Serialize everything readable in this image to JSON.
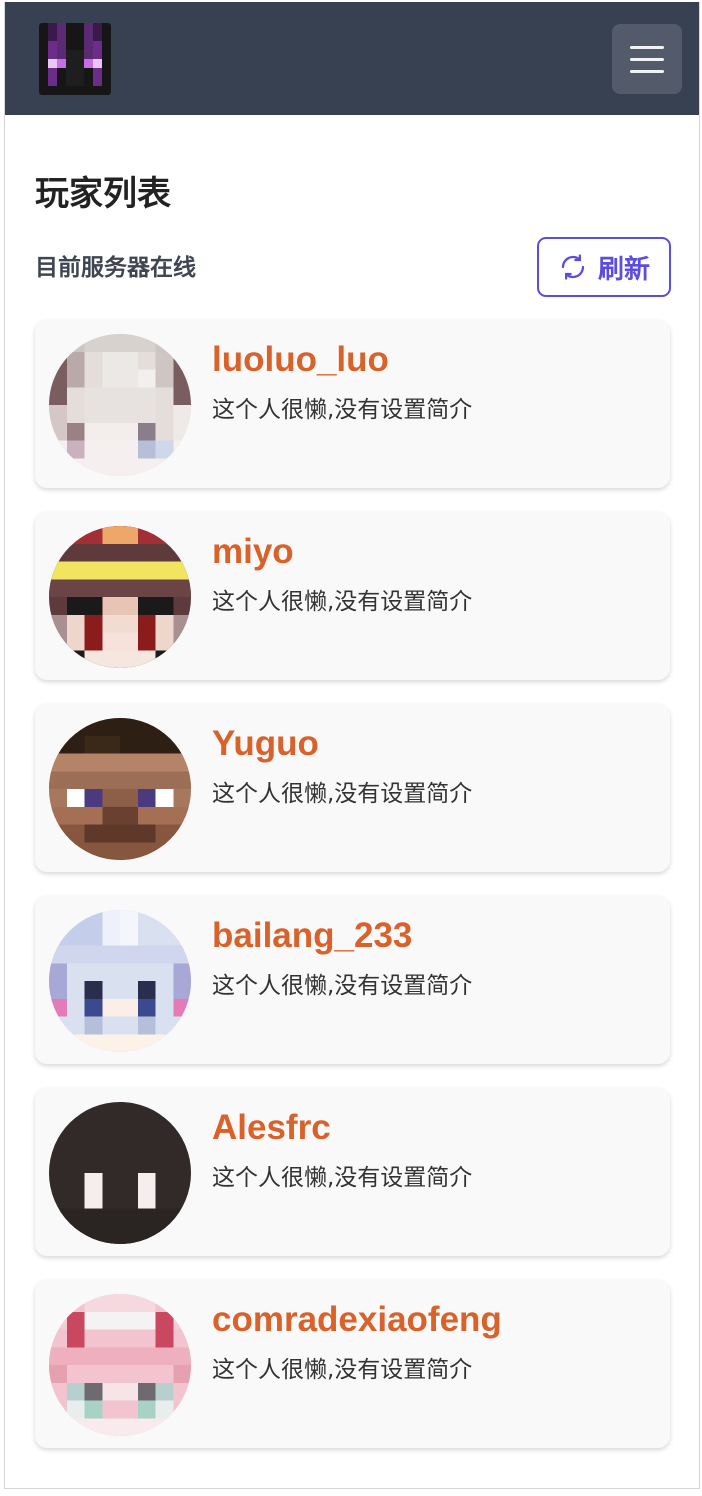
{
  "header": {
    "logo_icon": "enderman-face-icon",
    "menu_icon": "hamburger-menu-icon"
  },
  "page": {
    "title": "玩家列表",
    "subtitle": "目前服务器在线",
    "refresh_label": "刷新",
    "refresh_icon": "refresh-icon"
  },
  "colors": {
    "navbar": "#384152",
    "accent": "#5c4de0",
    "player_name": "#d9612a"
  },
  "players": [
    {
      "name": "luoluo_luo",
      "bio": "这个人很懒,没有设置简介"
    },
    {
      "name": "miyo",
      "bio": "这个人很懒,没有设置简介"
    },
    {
      "name": "Yuguo",
      "bio": "这个人很懒,没有设置简介"
    },
    {
      "name": "bailang_233",
      "bio": "这个人很懒,没有设置简介"
    },
    {
      "name": "Alesfrc",
      "bio": "这个人很懒,没有设置简介"
    },
    {
      "name": "comradexiaofeng",
      "bio": "这个人很懒,没有设置简介"
    }
  ]
}
